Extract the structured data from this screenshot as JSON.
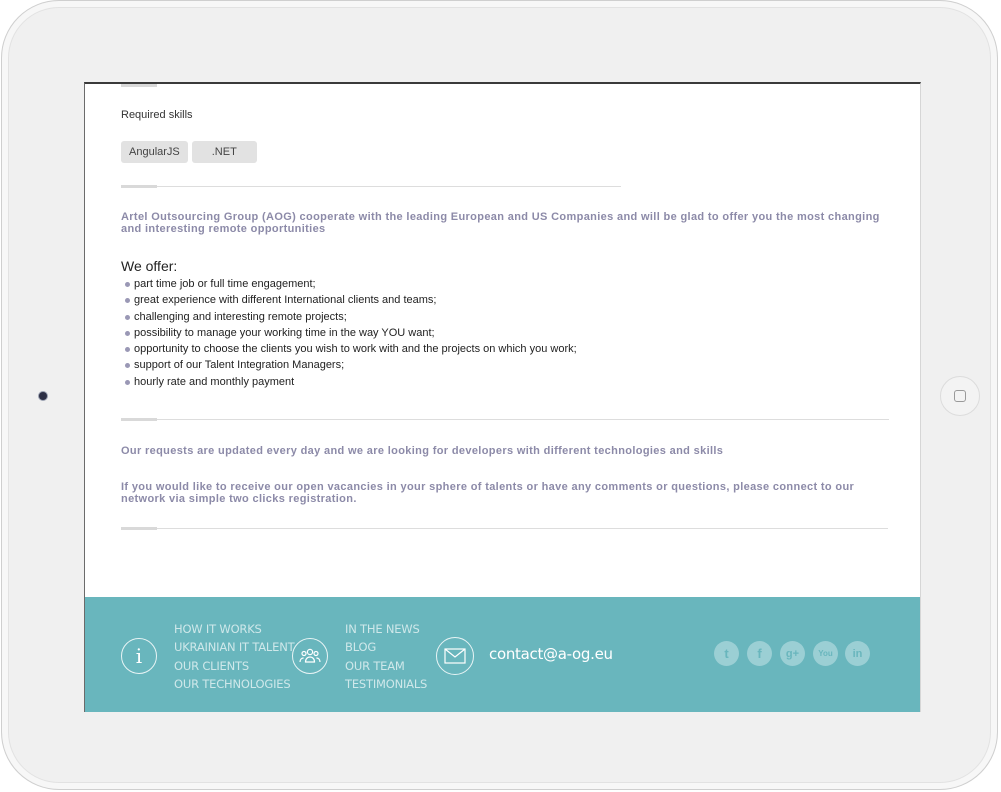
{
  "skills": {
    "label": "Required skills",
    "tags": [
      "AngularJS",
      ".NET"
    ]
  },
  "intro": "Artel Outsourcing Group (AOG) cooperate with the leading European and US Companies and will be glad to offer you the most changing and interesting remote opportunities",
  "offer": {
    "title": "We offer:",
    "items": [
      "part time job or full time engagement;",
      "great experience with different International clients and teams;",
      "challenging and interesting remote projects;",
      "possibility to manage your working time in the way YOU want;",
      "opportunity to choose the clients you wish to work with and the projects on which you work;",
      "support of our Talent Integration Managers;",
      "hourly rate and monthly payment"
    ]
  },
  "updates": "Our requests are updated every day and we are looking for developers with different technologies and skills",
  "cta": "If you would like to receive our open vacancies in your sphere of talents or have any comments or questions, please connect to our network via simple two clicks registration.",
  "footer": {
    "col1": [
      "HOW IT WORKS",
      "UKRAINIAN IT TALENT",
      "OUR CLIENTS",
      "OUR TECHNOLOGIES"
    ],
    "col2": [
      "IN THE NEWS",
      "BLOG",
      "OUR TEAM",
      "TESTIMONIALS"
    ],
    "contact": "contact@a-og.eu",
    "social": [
      "twitter-icon",
      "facebook-icon",
      "google-plus-icon",
      "youtube-icon",
      "linkedin-icon"
    ],
    "colors": {
      "background": "#69b6bd",
      "text": "#cfe8ea"
    }
  },
  "colors": {
    "accent_text": "#8c8aa8",
    "tag_bg": "#e2e2e2"
  }
}
